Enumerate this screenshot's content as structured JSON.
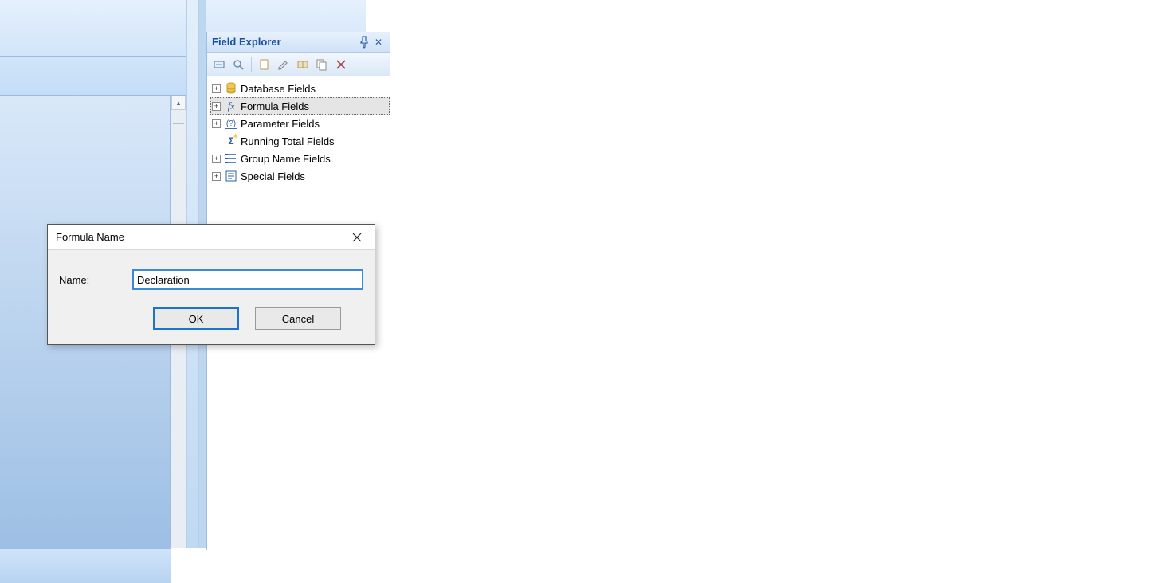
{
  "panel": {
    "title": "Field Explorer",
    "tree": [
      {
        "expandable": true,
        "icon": "database",
        "label": "Database Fields",
        "selected": false
      },
      {
        "expandable": true,
        "icon": "fx",
        "label": "Formula Fields",
        "selected": true
      },
      {
        "expandable": true,
        "icon": "parameter",
        "label": "Parameter Fields",
        "selected": false
      },
      {
        "expandable": false,
        "icon": "running-total",
        "label": "Running Total Fields",
        "selected": false
      },
      {
        "expandable": true,
        "icon": "group-name",
        "label": "Group Name Fields",
        "selected": false
      },
      {
        "expandable": true,
        "icon": "special",
        "label": "Special Fields",
        "selected": false
      }
    ]
  },
  "dialog": {
    "title": "Formula Name",
    "name_label": "Name:",
    "name_value": "Declaration",
    "ok_label": "OK",
    "cancel_label": "Cancel"
  }
}
